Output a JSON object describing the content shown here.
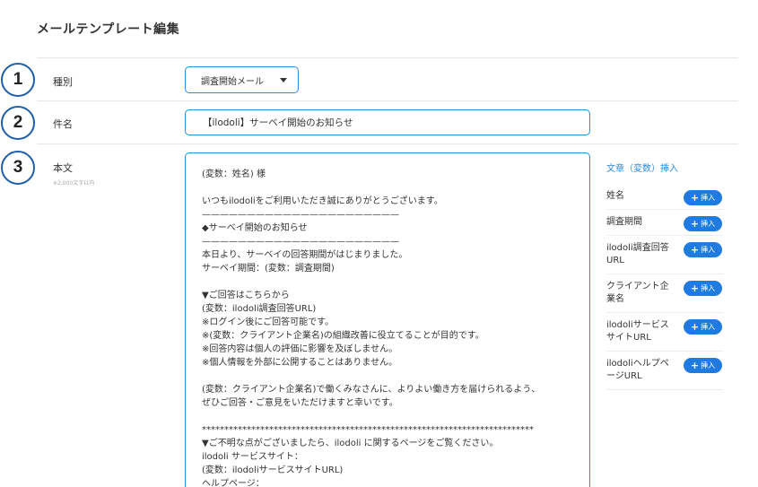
{
  "page": {
    "title": "メールテンプレート編集"
  },
  "steps": [
    "1",
    "2",
    "3"
  ],
  "fields": {
    "type": {
      "label": "種別",
      "value": "調査開始メール"
    },
    "subject": {
      "label": "件名",
      "value": "【ilodoli】サーベイ開始のお知らせ"
    },
    "body": {
      "label": "本文",
      "sublabel": "※2,000文字以内"
    }
  },
  "body_lines": [
    "(変数：姓名) 様",
    "",
    "いつもilodoliをご利用いただき誠にありがとうございます。",
    "——————————————————————",
    "◆サーベイ開始のお知らせ",
    "——————————————————————",
    "本日より、サーベイの回答期間がはじまりました。",
    "サーベイ期間：(変数：調査期間)",
    "",
    "▼ご回答はこちらから",
    "(変数：ilodoli調査回答URL)",
    "※ログイン後にご回答可能です。",
    "※(変数：クライアント企業名)の組織改善に役立てることが目的です。",
    "※回答内容は個人の評価に影響を及ぼしません。",
    "※個人情報を外部に公開することはありません。",
    "",
    "(変数：クライアント企業名)で働くみなさんに、よりよい働き方を届けられるよう、",
    "ぜひご回答・ご意見をいただけますと幸いです。",
    "",
    "**************************************************************************",
    "▼ご不明な点がございましたら、ilodoli に関するページをご覧ください。",
    "ilodoli サービスサイト：",
    "(変数：ilodoliサービスサイトURL)",
    "ヘルプページ："
  ],
  "insert_panel": {
    "title": "文章（変数）挿入",
    "button_label": "挿入",
    "button_plus": "+",
    "items": [
      {
        "lines": [
          "姓名"
        ]
      },
      {
        "lines": [
          "調査期間"
        ]
      },
      {
        "lines": [
          "ilodoli調査回答",
          "URL"
        ]
      },
      {
        "lines": [
          "クライアント企",
          "業名"
        ]
      },
      {
        "lines": [
          "ilodoliサービス",
          "サイトURL"
        ]
      },
      {
        "lines": [
          "ilodoliヘルプペ",
          "ージURL"
        ]
      }
    ]
  },
  "colors": {
    "accent": "#2a8be0",
    "button": "#1f7be0",
    "step_border": "#1e5fa8"
  }
}
